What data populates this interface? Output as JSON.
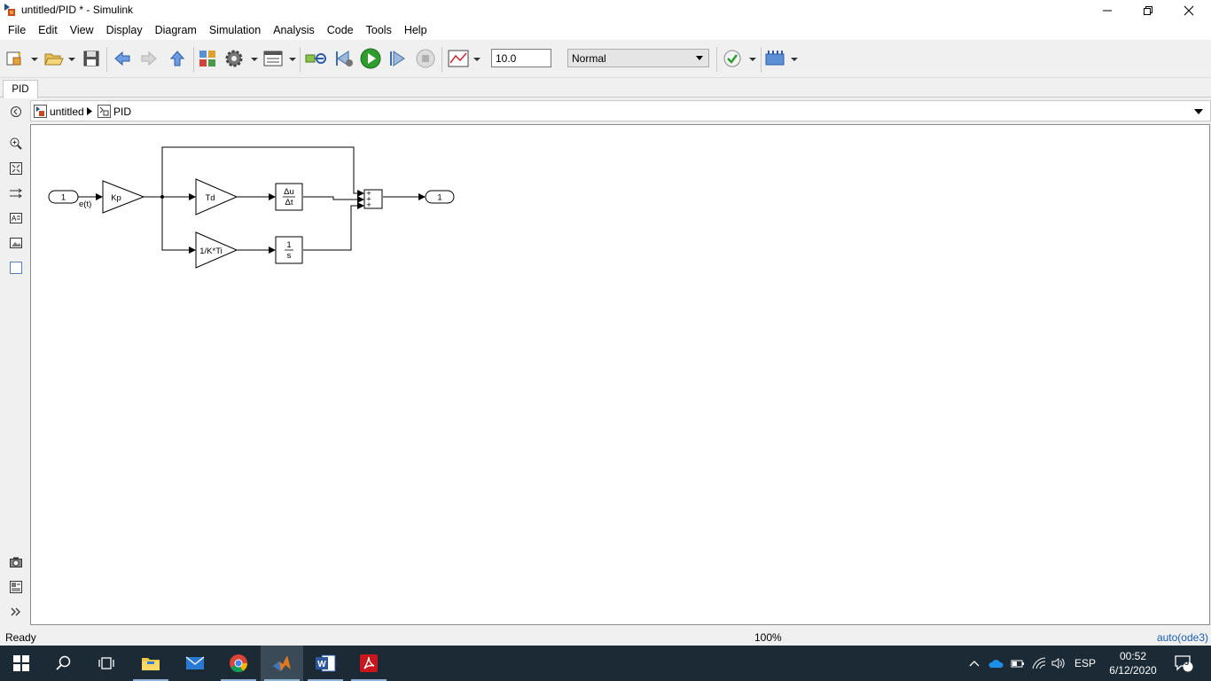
{
  "window": {
    "title": "untitled/PID * - Simulink",
    "minimize_icon": "minimize-icon",
    "maximize_icon": "restore-icon",
    "close_icon": "close-icon"
  },
  "menu": [
    "File",
    "Edit",
    "View",
    "Display",
    "Diagram",
    "Simulation",
    "Analysis",
    "Code",
    "Tools",
    "Help"
  ],
  "toolbar": {
    "stop_time": "10.0",
    "sim_mode": "Normal",
    "colors": {
      "run_green": "#2e9d2e",
      "nav_blue": "#3b7dd8"
    }
  },
  "tab": {
    "label": "PID"
  },
  "breadcrumb": {
    "root": "untitled",
    "child": "PID"
  },
  "diagram": {
    "inport_label": "1",
    "input_signal": "e(t)",
    "gain_kp": "Kp",
    "gain_td": "Td",
    "gain_ti": "1/K*Ti",
    "derivative_num": "Δu",
    "derivative_den": "Δt",
    "integrator_num": "1",
    "integrator_den": "s",
    "sum_signs": [
      "+",
      "+",
      "+"
    ],
    "outport_label": "1"
  },
  "status": {
    "text": "Ready",
    "zoom": "100%",
    "solver": "auto(ode3)"
  },
  "taskbar": {
    "apps": [
      "start-icon",
      "search-icon",
      "task-view-icon",
      "file-explorer-icon",
      "mail-icon",
      "chrome-icon",
      "matlab-icon",
      "word-icon",
      "acrobat-icon"
    ],
    "language": "ESP",
    "time": "00:52",
    "date": "6/12/2020",
    "notifications": "5"
  }
}
